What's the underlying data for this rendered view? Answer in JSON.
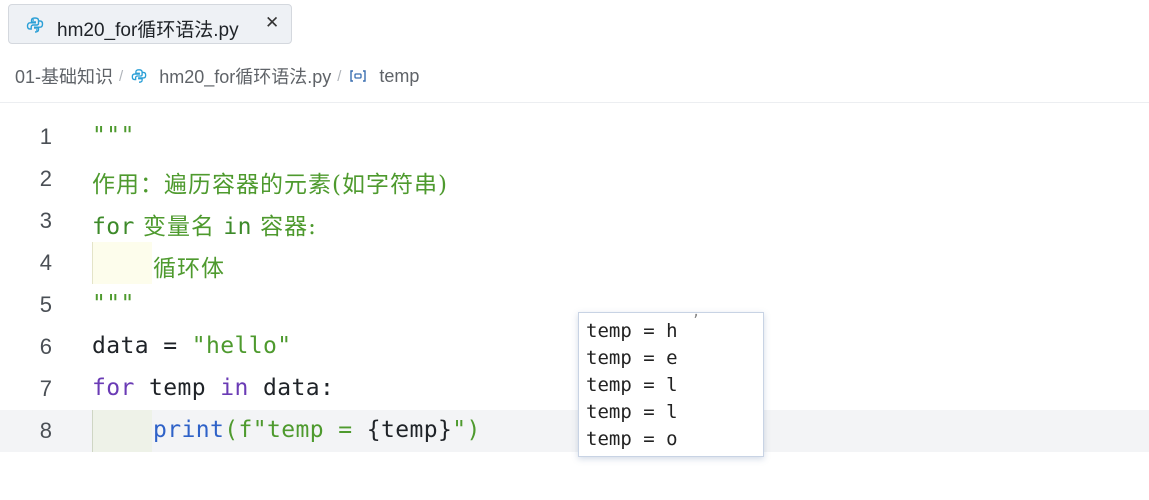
{
  "tab": {
    "title": "hm20_for循环语法.py",
    "close_symbol": "✕",
    "icon": "python-file-icon"
  },
  "breadcrumb": {
    "folder": "01-基础知识",
    "file": "hm20_for循环语法.py",
    "symbol": "temp",
    "separator": "/"
  },
  "editor": {
    "current_line": 8,
    "lines": [
      {
        "number": "1",
        "code": "\"\"\""
      },
      {
        "number": "2",
        "code": "作用：遍历容器的元素(如字符串)"
      },
      {
        "number": "3",
        "code_parts": [
          "for",
          " 变量名 ",
          "in",
          " 容器:"
        ]
      },
      {
        "number": "4",
        "code": "循环体"
      },
      {
        "number": "5",
        "code": "\"\"\""
      },
      {
        "number": "6",
        "code_parts": [
          "data",
          " = ",
          "\"hello\""
        ]
      },
      {
        "number": "7",
        "code_parts": [
          "for",
          " temp ",
          "in",
          " data:"
        ]
      },
      {
        "number": "8",
        "code_parts": [
          "print",
          "(f\"temp = ",
          "{",
          "temp",
          "}",
          "\")"
        ]
      }
    ]
  },
  "output_popup": {
    "lines": [
      "temp = h",
      "temp = e",
      "temp = l",
      "temp = l",
      "temp = o"
    ]
  },
  "colors": {
    "string": "#4e9a2e",
    "keyword": "#3d8a2a",
    "keyword_purple": "#6a3bb5",
    "function": "#2f62c8",
    "current_line_bg": "#f3f4f6"
  }
}
